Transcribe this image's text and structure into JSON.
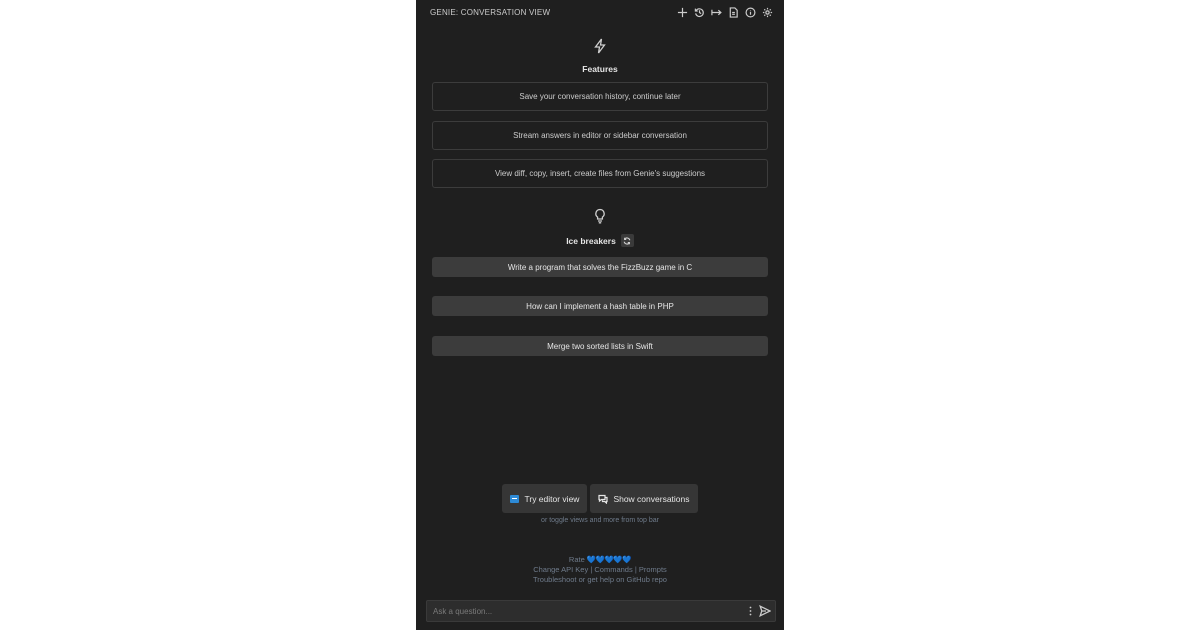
{
  "header": {
    "title": "GENIE: CONVERSATION VIEW",
    "actions": [
      "plus-icon",
      "history-icon",
      "arrow-right-icon",
      "document-icon",
      "info-icon",
      "gear-icon"
    ]
  },
  "features": {
    "title": "Features",
    "icon": "lightning-icon",
    "items": [
      "Save your conversation history, continue later",
      "Stream answers in editor or sidebar conversation",
      "View diff, copy, insert, create files from Genie's suggestions"
    ]
  },
  "icebreakers": {
    "title": "Ice breakers",
    "icon": "lightbulb-icon",
    "items": [
      "Write a program that solves the FizzBuzz game in C",
      "How can I implement a hash table in PHP",
      "Merge two sorted lists in Swift"
    ]
  },
  "views": {
    "try_editor": "Try editor view",
    "show_conversations": "Show conversations",
    "hint": "or toggle views and more from top bar"
  },
  "footer": {
    "rate_label": "Rate",
    "hearts": "💙💙💙💙💙",
    "change_api_key": "Change API Key",
    "commands": "Commands",
    "prompts": "Prompts",
    "separator": "|",
    "help": "Troubleshoot or get help on GitHub repo"
  },
  "input": {
    "placeholder": "Ask a question..."
  },
  "colors": {
    "panel_bg": "#1f1f1f",
    "button_bg": "#3c3c3c",
    "accent": "#2d8ad6",
    "muted_text": "#6f7b8b"
  }
}
